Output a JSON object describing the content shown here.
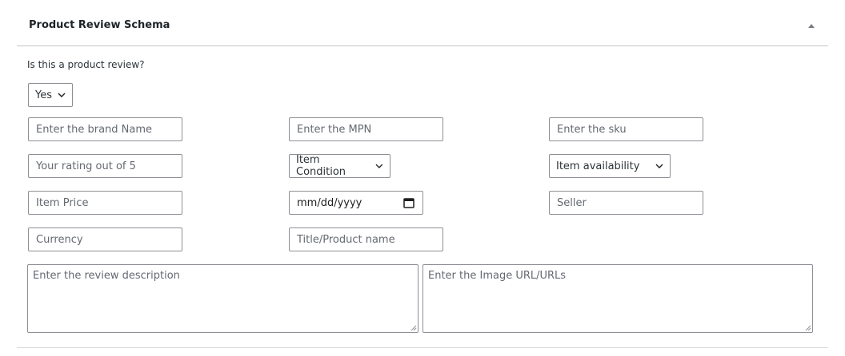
{
  "metabox": {
    "title": "Product Review Schema"
  },
  "review_question": {
    "label": "Is this a product review?",
    "selected": "Yes"
  },
  "fields": {
    "brand_placeholder": "Enter the brand Name",
    "mpn_placeholder": "Enter the MPN",
    "sku_placeholder": "Enter the sku",
    "rating_placeholder": "Your rating out of 5",
    "item_condition_selected": "Item Condition",
    "item_availability_selected": "Item availability",
    "price_placeholder": "Item Price",
    "date_placeholder": "mm/dd/yyyy",
    "seller_placeholder": "Seller",
    "currency_placeholder": "Currency",
    "title_placeholder": "Title/Product name",
    "description_placeholder": "Enter the review description",
    "image_urls_placeholder": "Enter the Image URL/URLs"
  }
}
